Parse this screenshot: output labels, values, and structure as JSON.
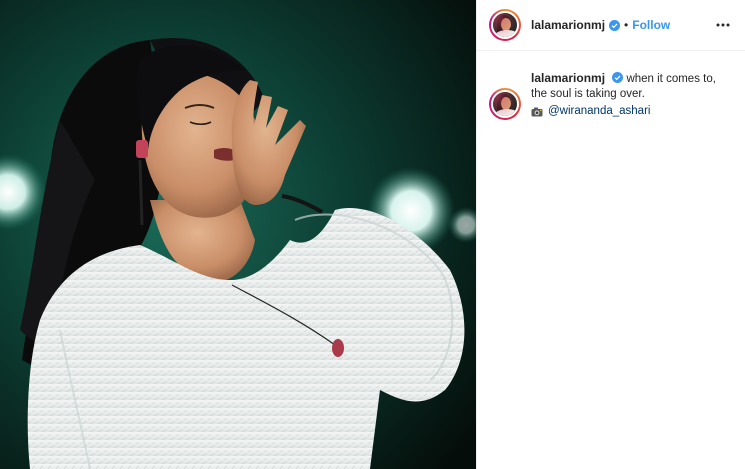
{
  "post": {
    "username": "lalamarionmj",
    "follow_label": "Follow",
    "separator": "•",
    "caption": {
      "username": "lalamarionmj",
      "text": "when it comes to, the soul is taking over.",
      "credit_icon": "camera-emoji-icon",
      "mention": "@wirananda_ashari"
    }
  },
  "colors": {
    "follow_blue": "#3897f0",
    "mention_blue": "#003569",
    "verified_blue": "#3897f0",
    "stage_green": "#0f5a48"
  },
  "icons": {
    "verified": "verified-badge-icon",
    "more": "more-options-icon",
    "camera": "camera-emoji-icon"
  }
}
